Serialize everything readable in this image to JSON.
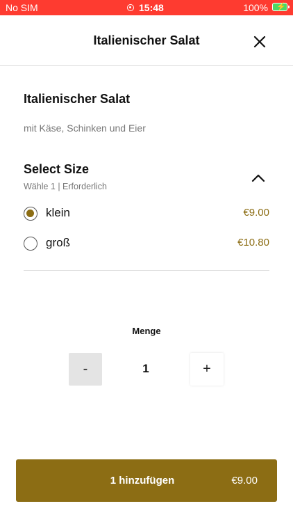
{
  "status_bar": {
    "carrier": "No SIM",
    "time": "15:48",
    "battery": "100%"
  },
  "header": {
    "title": "Italienischer Salat",
    "close_icon": "close-icon"
  },
  "item": {
    "title": "Italienischer Salat",
    "description": "mit Käse, Schinken und Eier"
  },
  "size_section": {
    "title": "Select Size",
    "subtitle": "Wähle 1  |  Erforderlich",
    "toggle_icon": "chevron-up-icon",
    "options": [
      {
        "label": "klein",
        "price": "€9.00",
        "selected": true
      },
      {
        "label": "groß",
        "price": "€10.80",
        "selected": false
      }
    ]
  },
  "quantity": {
    "label": "Menge",
    "minus": "-",
    "value": "1",
    "plus": "+"
  },
  "add_button": {
    "label": "1 hinzufügen",
    "price": "€9.00"
  },
  "colors": {
    "status_bar": "#fe3b30",
    "accent": "#8c6d14"
  }
}
